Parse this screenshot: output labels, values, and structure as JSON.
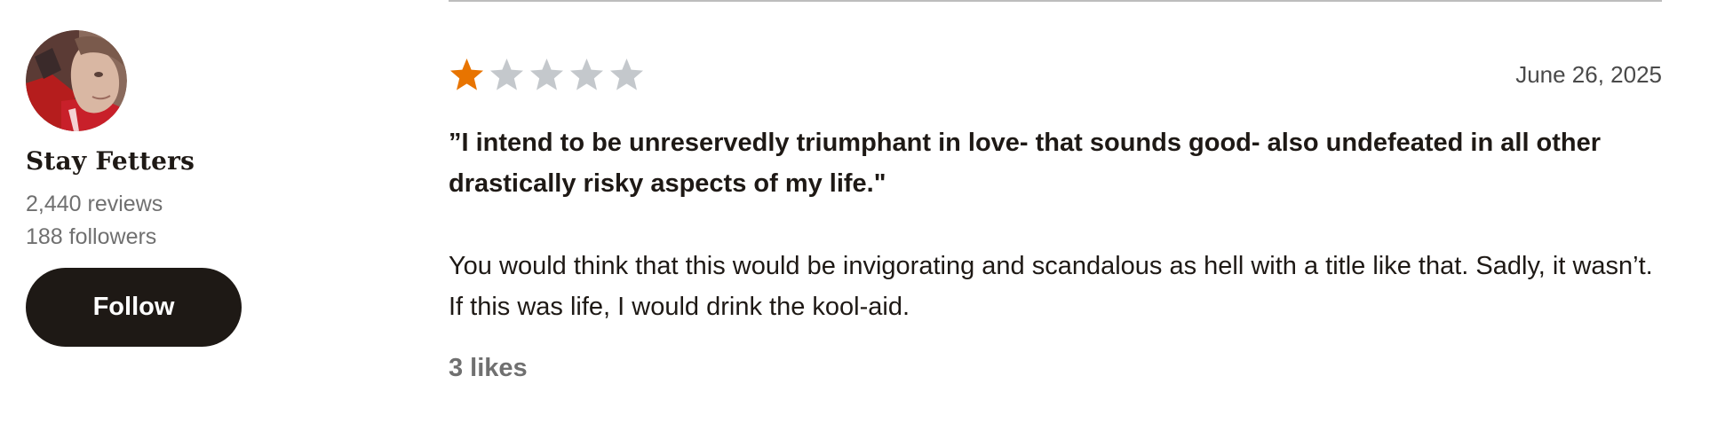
{
  "reviewer": {
    "name": "Stay Fetters",
    "reviews": "2,440 reviews",
    "followers": "188 followers",
    "follow_label": "Follow",
    "avatar_icon": "user-avatar-photo"
  },
  "review": {
    "rating": 1,
    "max_rating": 5,
    "date": "June 26, 2025",
    "quote": "”I intend to be unreservedly triumphant in love- that sounds good- also undefeated in all other drastically risky aspects of my life.\"",
    "body": "You would think that this would be invigorating and scandalous as hell with a title like that. Sadly, it wasn’t. If this was life, I would drink the kool-aid.",
    "likes": "3 likes"
  },
  "colors": {
    "star_filled": "#e87400",
    "star_empty": "#c4c8cc",
    "button_bg": "#1e1915",
    "muted_text": "#707070"
  }
}
